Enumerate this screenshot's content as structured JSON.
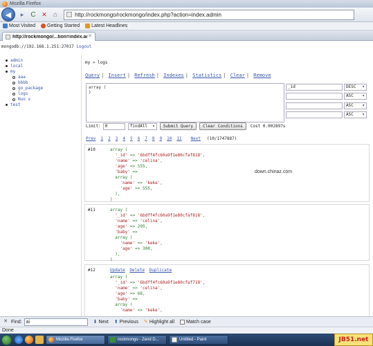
{
  "window": {
    "title": "Mozilla Firefox"
  },
  "nav": {
    "url": "http://rockmongo/rockmongo/index.php?action=index.admin",
    "back_glyph": "◀",
    "forward_glyph": "▸",
    "reload_glyph": "C",
    "stop_glyph": "✕",
    "home_glyph": "⌂"
  },
  "bookmarks": [
    {
      "label": "Most Visited",
      "icon": "most-visited-icon"
    },
    {
      "label": "Getting Started",
      "icon": "getting-started-icon"
    },
    {
      "label": "Latest Headlines",
      "icon": "rss-icon"
    }
  ],
  "tab": {
    "label": "http://rockmongo/...tion=index.admin",
    "close_glyph": "✕"
  },
  "server": {
    "text": "mongodb://192.168.1.251:27017",
    "logout": "Logout"
  },
  "tree": {
    "top": [
      "admin",
      "local",
      "my"
    ],
    "my_children": [
      "aaa",
      "bbbb",
      "go_package",
      "logs",
      "Nuo s"
    ],
    "bottom": [
      "test"
    ]
  },
  "collection": {
    "heading": "my » logs"
  },
  "menu": [
    "Query",
    "Insert",
    "Refresh",
    "Indexes",
    "Statistics",
    "Clear",
    "Remove"
  ],
  "query": {
    "text_line1": "array (",
    "text_line2": ")",
    "sort_field": "_id",
    "sort_orders": [
      "DESC",
      "ASC",
      "ASC",
      "ASC"
    ],
    "limit_label": "Limit:",
    "limit_value": "0",
    "find_mode": "findAll",
    "submit_label": "Submit Query",
    "clear_label": "Clear Conditions",
    "cost": "Cost 0.002897s"
  },
  "pager": {
    "prev": "Prev",
    "pages": [
      "1",
      "2",
      "3",
      "4",
      "5",
      "6",
      "7",
      "8",
      "9",
      "10",
      "11"
    ],
    "next": "Next",
    "count": "(10/1747887)"
  },
  "records": [
    {
      "no": "#10",
      "lines": [
        "array (",
        "  '_id' => '6bdff4fc60a9f1e80cfaf818',",
        "  'name' => 'celina',",
        "  'age' => 555,",
        "  'baby' =>",
        "  array (",
        "    'name' => 'keke',",
        "    'age' => 555,",
        "  ),",
        ")"
      ]
    },
    {
      "no": "#11",
      "lines": [
        "array (",
        "  '_id' => '6bdff4fc60a9f1e80cfaf818',",
        "  'name' => 'celina',",
        "  'age' => 295,",
        "  'baby' =>",
        "  array (",
        "    'name' => 'keke',",
        "    'age' => 300,",
        "  ),",
        ")"
      ]
    },
    {
      "no": "#12",
      "actions": [
        "Update",
        "Delete",
        "Duplicate"
      ],
      "lines": [
        "array (",
        "  '_id' => '6bdff4fc60a9f1e80cfaf718',",
        "  'name' => 'celina',",
        "  'age' => 68,",
        "  'baby' =>",
        "  array (",
        "    'name' => 'keke',"
      ]
    }
  ],
  "watermark": "down.chinaz.com",
  "findbar": {
    "label": "Find:",
    "value": "ai",
    "next": "Next",
    "previous": "Previous",
    "highlight": "Highlight all",
    "match_case": "Match case"
  },
  "status": "Done",
  "taskbar": {
    "buttons": [
      "Mozilla Firefox",
      "rockmongo - Zend D...",
      "Untitled - Paint"
    ],
    "brand": "JB51.net"
  }
}
